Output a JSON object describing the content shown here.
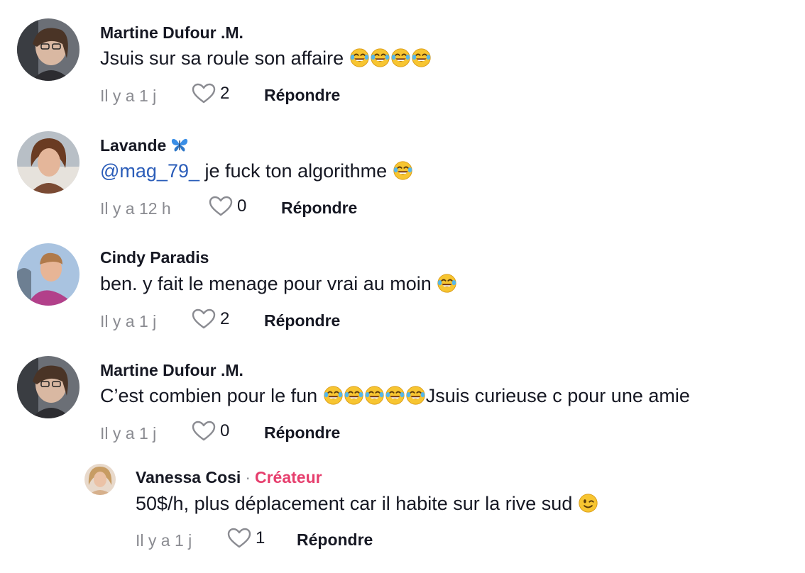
{
  "comments": [
    {
      "username": "Martine Dufour .M.",
      "text": "Jsuis sur sa roule son affaire",
      "emoji_count": 4,
      "time": "Il y a 1 j",
      "likes": "2",
      "reply_label": "Répondre"
    },
    {
      "username": "Lavande",
      "username_icon": "butterfly-icon",
      "mention": "@mag_79_",
      "text": " je fuck ton algorithme",
      "emoji_count": 1,
      "time": "Il y a 12 h",
      "likes": "0",
      "reply_label": "Répondre"
    },
    {
      "username": "Cindy Paradis",
      "text": "ben. y fait le menage pour vrai au moin",
      "emoji_count": 1,
      "time": "Il y a 1 j",
      "likes": "2",
      "reply_label": "Répondre"
    },
    {
      "username": "Martine Dufour .M.",
      "text_before": "C’est combien pour le fun",
      "emoji_count": 5,
      "text_after": "Jsuis curieuse c pour une amie",
      "time": "Il y a 1 j",
      "likes": "0",
      "reply_label": "Répondre"
    }
  ],
  "reply": {
    "username": "Vanessa Cosi",
    "separator": "·",
    "badge": "Créateur",
    "text": "50$/h, plus déplacement car il habite sur la rive sud",
    "emoji": "winking-face",
    "time": "Il y a 1 j",
    "likes": "1",
    "reply_label": "Répondre"
  },
  "colors": {
    "text": "#161823",
    "muted": "#8a8b91",
    "mention": "#2b5db9",
    "creator_badge": "#e63e6d"
  },
  "icons": {
    "like": "heart-outline-icon",
    "laugh": "face-with-tears-of-joy-emoji",
    "wink": "winking-face-emoji",
    "butterfly": "butterfly-emoji"
  }
}
